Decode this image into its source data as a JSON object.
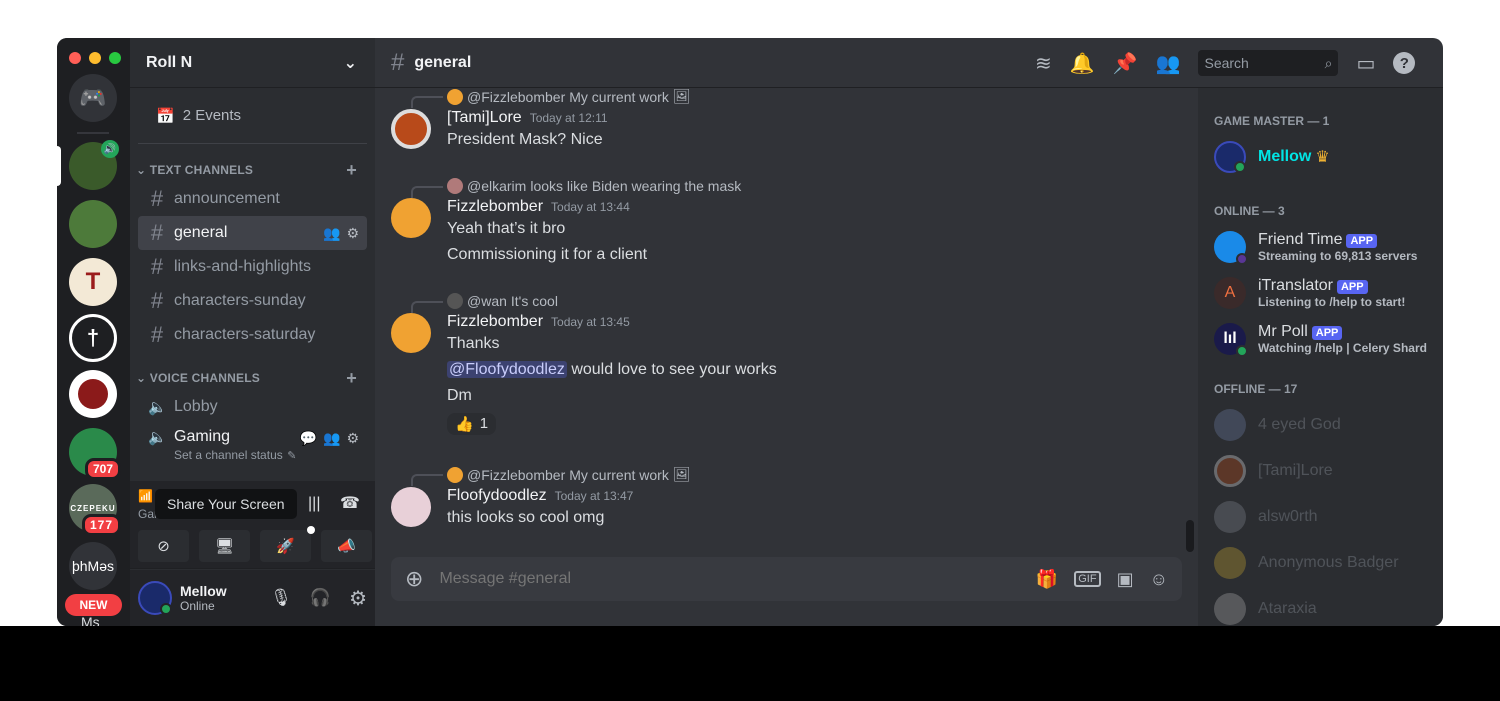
{
  "server": {
    "name": "Roll N",
    "events": "2 Events",
    "rail": [
      {
        "label": "",
        "badge": ""
      },
      {
        "label": "",
        "badge": ""
      },
      {
        "label": "T",
        "badge": ""
      },
      {
        "label": "",
        "badge": ""
      },
      {
        "label": "",
        "badge": ""
      },
      {
        "label": "",
        "badge": "707"
      },
      {
        "label": "CZEPEKU",
        "badge": "177"
      },
      {
        "label": "þhMəs",
        "badge": ""
      }
    ],
    "new_badge": "NEW",
    "rail_partial": "Ms"
  },
  "channels": {
    "text_header": "TEXT CHANNELS",
    "voice_header": "VOICE CHANNELS",
    "text": [
      "announcement",
      "general",
      "links-and-highlights",
      "characters-sunday",
      "characters-saturday"
    ],
    "selected": "general",
    "voice": [
      {
        "name": "Lobby",
        "status": ""
      },
      {
        "name": "Gaming",
        "status": "Set a channel status"
      }
    ]
  },
  "voice_panel": {
    "tooltip": "Share Your Screen",
    "partial_label": "Gar"
  },
  "user": {
    "name": "Mellow",
    "status": "Online"
  },
  "header": {
    "channel": "general",
    "search_placeholder": "Search"
  },
  "messages": [
    {
      "reply_to": "@Fizzlebomber",
      "reply_text": "My current work",
      "author": "[Tami]Lore",
      "time": "Today at 12:11",
      "lines": [
        "President Mask? Nice"
      ]
    },
    {
      "reply_to": "@elkarim",
      "reply_text": "looks like Biden wearing the mask",
      "author": "Fizzlebomber",
      "time": "Today at 13:44",
      "lines": [
        "Yeah that’s it bro",
        "Commissioning it for a client"
      ]
    },
    {
      "reply_to": "@wan",
      "reply_text": "It's cool",
      "author": "Fizzlebomber",
      "time": "Today at 13:45",
      "lines": [
        "Thanks"
      ],
      "mention": "@Floofydoodlez",
      "mention_text": "would love to see your works",
      "extra": "Dm",
      "reaction": {
        "emoji": "👍",
        "count": "1"
      }
    },
    {
      "reply_to": "@Fizzlebomber",
      "reply_text": "My current work",
      "author": "Floofydoodlez",
      "time": "Today at 13:47",
      "lines": [
        "this looks so cool omg"
      ]
    }
  ],
  "composer": {
    "placeholder": "Message #general"
  },
  "members": {
    "gm_header": "GAME MASTER — 1",
    "gm": {
      "name": "Mellow",
      "color": "#00e5e5"
    },
    "online_header": "ONLINE — 3",
    "online": [
      {
        "name": "Friend Time",
        "tag": "APP",
        "status": "Streaming to 69,813 servers"
      },
      {
        "name": "iTranslator",
        "tag": "APP",
        "status": "Listening to /help to start!"
      },
      {
        "name": "Mr Poll",
        "tag": "APP",
        "status": "Watching /help | Celery Shard"
      }
    ],
    "offline_header": "OFFLINE — 17",
    "offline": [
      "4 eyed God",
      "[Tami]Lore",
      "alsw0rth",
      "Anonymous Badger",
      "Ataraxia"
    ]
  },
  "colors": {
    "accent": "#5865f2",
    "online": "#23a55a",
    "badge": "#f23f43",
    "fizzle": "#f0a232"
  }
}
